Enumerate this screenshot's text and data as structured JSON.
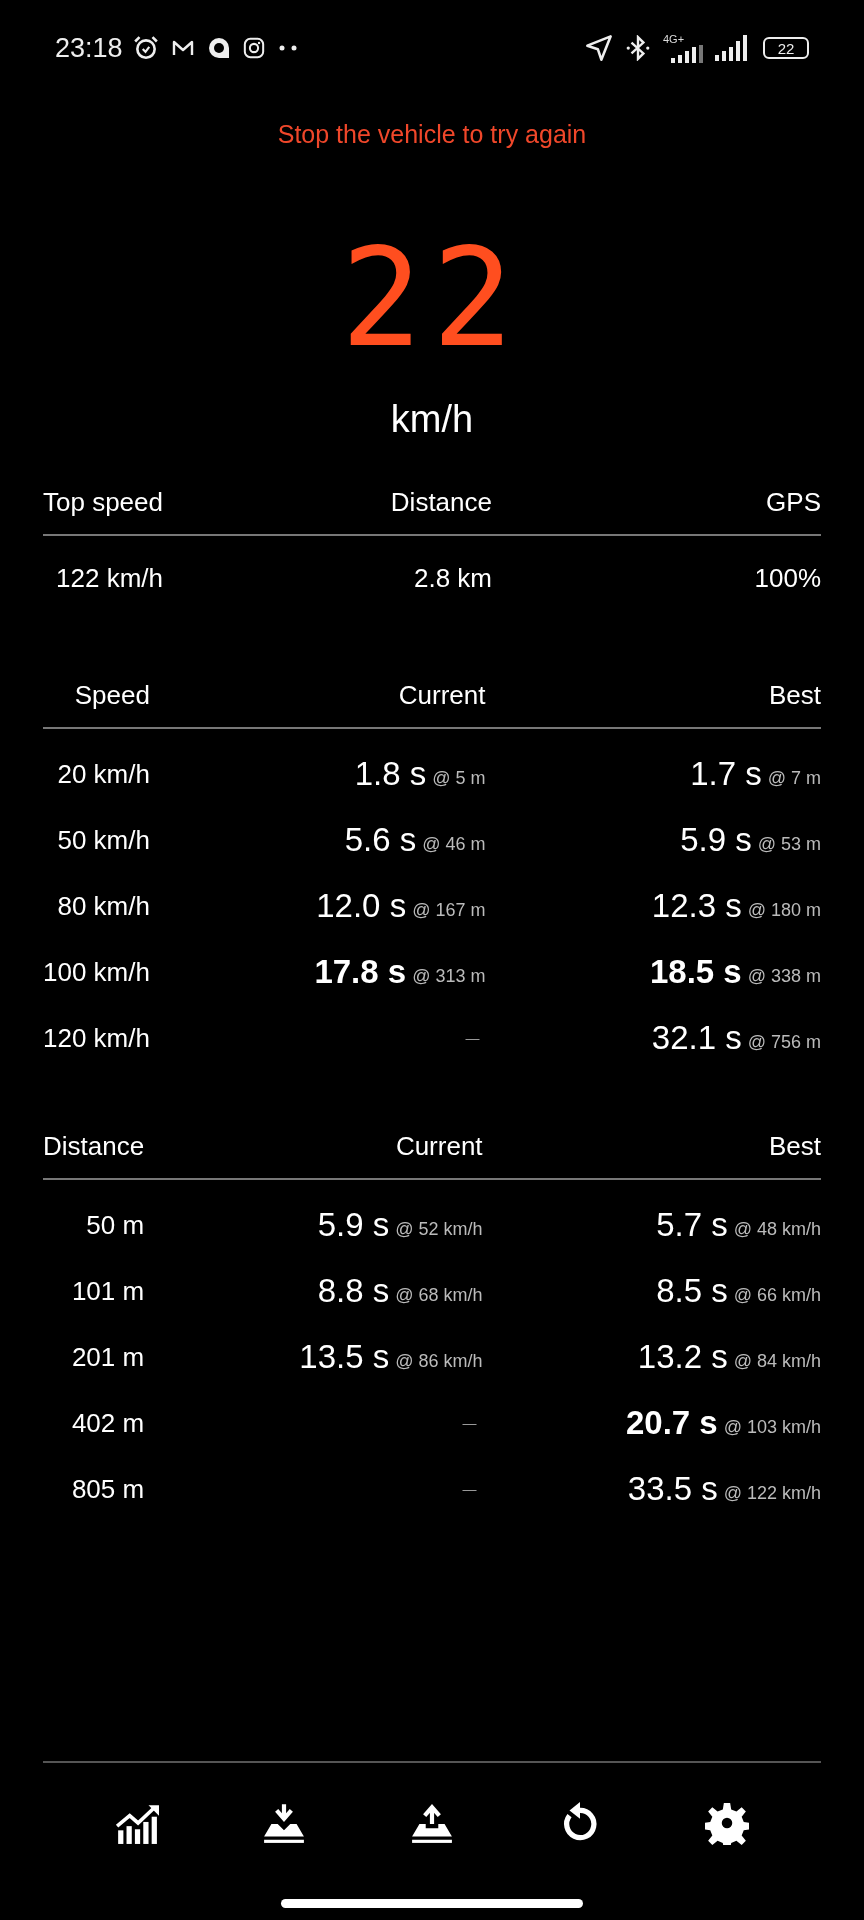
{
  "status_bar": {
    "time": "23:18",
    "network": "4G+",
    "battery": "22"
  },
  "message": "Stop the vehicle to try again",
  "speed": {
    "value": "22",
    "unit": "km/h"
  },
  "summary": {
    "columns": [
      "Top speed",
      "Distance",
      "GPS"
    ],
    "values": [
      "122 km/h",
      "2.8 km",
      "100%"
    ]
  },
  "speed_table": {
    "columns": [
      "Speed",
      "Current",
      "Best"
    ],
    "rows": [
      {
        "label": "20 km/h",
        "current": {
          "kind": "value",
          "time": "1.8 s",
          "at": "@ 5 m",
          "bold": false
        },
        "best": {
          "kind": "value",
          "time": "1.7 s",
          "at": "@ 7 m",
          "bold": false
        }
      },
      {
        "label": "50 km/h",
        "current": {
          "kind": "value",
          "time": "5.6 s",
          "at": "@ 46 m",
          "bold": false
        },
        "best": {
          "kind": "value",
          "time": "5.9 s",
          "at": "@ 53 m",
          "bold": false
        }
      },
      {
        "label": "80 km/h",
        "current": {
          "kind": "value",
          "time": "12.0 s",
          "at": "@ 167 m",
          "bold": false
        },
        "best": {
          "kind": "value",
          "time": "12.3 s",
          "at": "@ 180 m",
          "bold": false
        }
      },
      {
        "label": "100 km/h",
        "current": {
          "kind": "value",
          "time": "17.8 s",
          "at": "@ 313 m",
          "bold": true
        },
        "best": {
          "kind": "value",
          "time": "18.5 s",
          "at": "@ 338 m",
          "bold": true
        }
      },
      {
        "label": "120 km/h",
        "current": {
          "kind": "empty",
          "text": "—"
        },
        "best": {
          "kind": "value",
          "time": "32.1 s",
          "at": "@ 756 m",
          "bold": false
        }
      }
    ]
  },
  "distance_table": {
    "columns": [
      "Distance",
      "Current",
      "Best"
    ],
    "rows": [
      {
        "label": "50 m",
        "current": {
          "kind": "value",
          "time": "5.9 s",
          "at": "@ 52 km/h",
          "bold": false
        },
        "best": {
          "kind": "value",
          "time": "5.7 s",
          "at": "@ 48 km/h",
          "bold": false
        }
      },
      {
        "label": "101 m",
        "current": {
          "kind": "value",
          "time": "8.8 s",
          "at": "@ 68 km/h",
          "bold": false
        },
        "best": {
          "kind": "value",
          "time": "8.5 s",
          "at": "@ 66 km/h",
          "bold": false
        }
      },
      {
        "label": "201 m",
        "current": {
          "kind": "value",
          "time": "13.5 s",
          "at": "@ 86 km/h",
          "bold": false
        },
        "best": {
          "kind": "value",
          "time": "13.2 s",
          "at": "@ 84 km/h",
          "bold": false
        }
      },
      {
        "label": "402 m",
        "current": {
          "kind": "empty",
          "text": "—"
        },
        "best": {
          "kind": "value",
          "time": "20.7 s",
          "at": "@ 103 km/h",
          "bold": true
        }
      },
      {
        "label": "805 m",
        "current": {
          "kind": "empty",
          "text": "—"
        },
        "best": {
          "kind": "value",
          "time": "33.5 s",
          "at": "@ 122 km/h",
          "bold": false
        }
      }
    ]
  },
  "toolbar": [
    {
      "kind": "chart"
    },
    {
      "kind": "download"
    },
    {
      "kind": "upload"
    },
    {
      "kind": "reset"
    },
    {
      "kind": "settings"
    }
  ]
}
